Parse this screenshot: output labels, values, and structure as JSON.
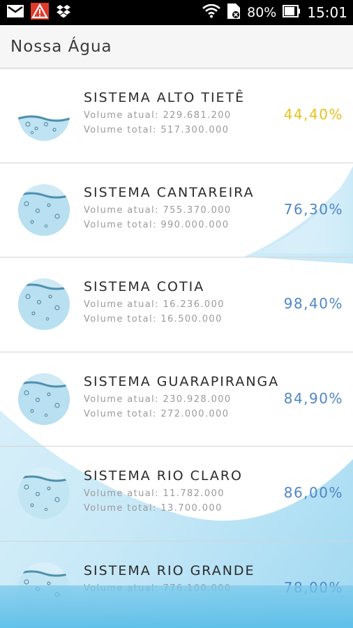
{
  "status_bar": {
    "battery": "80%",
    "time": "15:01",
    "icons_left": [
      "mail-icon",
      "warning-triangle-icon",
      "dropbox-icon"
    ],
    "icons_right": [
      "wifi-icon",
      "sim-card-icon",
      "battery-icon"
    ]
  },
  "app": {
    "title": "Nossa Água"
  },
  "systems": [
    {
      "name": "SISTEMA ALTO TIETÊ",
      "atual": "Volume atual: 229.681.200",
      "total": "Volume total: 517.300.000",
      "percent": "44,40%",
      "color": "#e6c21a"
    },
    {
      "name": "SISTEMA CANTAREIRA",
      "atual": "Volume atual: 755.370.000",
      "total": "Volume total: 990.000.000",
      "percent": "76,30%",
      "color": "#4f86c6"
    },
    {
      "name": "SISTEMA COTIA",
      "atual": "Volume atual: 16.236.000",
      "total": "Volume total: 16.500.000",
      "percent": "98,40%",
      "color": "#4f86c6"
    },
    {
      "name": "SISTEMA GUARAPIRANGA",
      "atual": "Volume atual: 230.928.000",
      "total": "Volume total: 272.000.000",
      "percent": "84,90%",
      "color": "#4f86c6"
    },
    {
      "name": "SISTEMA RIO CLARO",
      "atual": "Volume atual: 11.782.000",
      "total": "Volume total: 13.700.000",
      "percent": "86,00%",
      "color": "#4f86c6"
    },
    {
      "name": "SISTEMA RIO GRANDE",
      "atual": "Volume atual: 776.100.000",
      "total": "",
      "percent": "78,00%",
      "color": "#4f86c6"
    }
  ]
}
